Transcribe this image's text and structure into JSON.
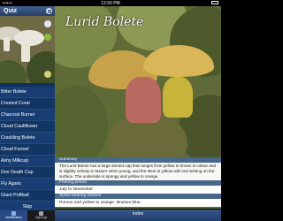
{
  "status_bar": {
    "signal": "•••••",
    "time": "12:50 PM"
  },
  "sidebar": {
    "title": "Quiz",
    "items": [
      {
        "label": "Bitter Bolete"
      },
      {
        "label": "Crested Coral"
      },
      {
        "label": "Charcoal Burner"
      },
      {
        "label": "Cloud Cauliflower"
      },
      {
        "label": "Crackling Bolete"
      },
      {
        "label": "Cloud Funnel"
      },
      {
        "label": "Ashy Milkcap"
      },
      {
        "label": "Dee Death Cap"
      },
      {
        "label": "Fly Agaric"
      },
      {
        "label": "Giant Puffball"
      },
      {
        "label": "Skip"
      }
    ]
  },
  "tabs": [
    {
      "label": "Identification",
      "active": true
    },
    {
      "label": "Sightings",
      "active": false
    }
  ],
  "main": {
    "mushroom_name": "Lurid Bolete",
    "summary_header": "Summary",
    "summary_text": "The Lurid Bolete has a large domed cap that ranges from yellow to brown in colour and is slightly velvety in texture when young, and the stem is yellow with red veining on the surface. The underside is spongy and yellow to orange.",
    "fruiting_header": "Fruiting period",
    "fruiting_value": "July to November",
    "spore_header": "Spore bearing surface",
    "spore_value": "Porous and yellow to orange. Bruises blue.",
    "index_label": "Index"
  },
  "colors": {
    "sidebar_bg": "#10305e",
    "accent": "#2b4b86",
    "header_blue": "#4668a0"
  }
}
